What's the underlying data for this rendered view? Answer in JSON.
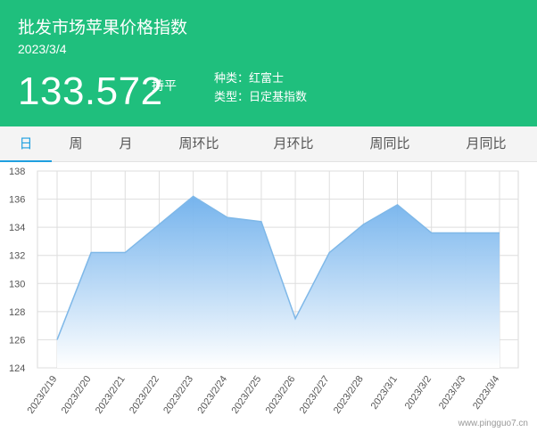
{
  "header": {
    "title": "批发市场苹果价格指数",
    "date": "2023/3/4",
    "value": "133.572",
    "change": "持平",
    "kind": "种类：红富士",
    "type": "类型：日定基指数"
  },
  "tabs": [
    {
      "label": "日",
      "active": true
    },
    {
      "label": "周",
      "active": false
    },
    {
      "label": "月",
      "active": false
    },
    {
      "label": "周环比",
      "active": false
    },
    {
      "label": "月环比",
      "active": false
    },
    {
      "label": "周同比",
      "active": false
    },
    {
      "label": "月同比",
      "active": false
    }
  ],
  "watermark": "www.pingguo7.cn",
  "colors": {
    "header_bg": "#1fbf7d",
    "tab_active": "#1fa0e0",
    "series_line": "#7fb8e8",
    "series_fill_top": "#6fb0ec",
    "series_fill_bottom": "#ffffff"
  },
  "chart_data": {
    "type": "area",
    "x": [
      "2023/2/19",
      "2023/2/20",
      "2023/2/21",
      "2023/2/22",
      "2023/2/23",
      "2023/2/24",
      "2023/2/25",
      "2023/2/26",
      "2023/2/27",
      "2023/2/28",
      "2023/3/1",
      "2023/3/2",
      "2023/3/3",
      "2023/3/4"
    ],
    "series": [
      {
        "values": [
          126.0,
          132.2,
          132.2,
          134.2,
          136.2,
          134.7,
          134.4,
          127.5,
          132.2,
          134.2,
          135.6,
          133.6,
          133.6,
          133.6
        ]
      }
    ],
    "yticks": [
      124,
      126,
      128,
      130,
      132,
      134,
      136,
      138
    ],
    "ylim": [
      124,
      138
    ],
    "grid": true,
    "title": "",
    "xlabel": "",
    "ylabel": ""
  }
}
